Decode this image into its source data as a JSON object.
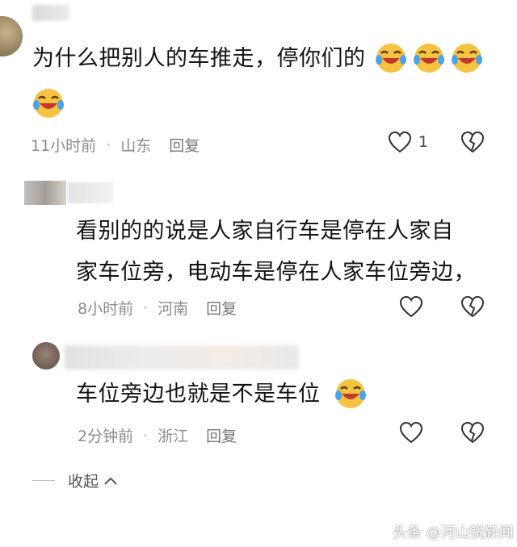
{
  "comments": [
    {
      "text_line1": "为什么把别人的车推走，停你们的",
      "time": "11小时前",
      "location": "山东",
      "reply": "回复",
      "likes": "1",
      "emoji_count": 4
    },
    {
      "text_line1": "看别的的说是人家自行车是停在人家自",
      "text_line2": "家车位旁，电动车是停在人家车位旁边，",
      "time": "8小时前",
      "location": "河南",
      "reply": "回复"
    },
    {
      "text_line1": "车位旁边也就是不是车位",
      "time": "2分钟前",
      "location": "浙江",
      "reply": "回复",
      "emoji_count": 1
    }
  ],
  "collapse_label": "收起",
  "watermark": "头条 @河山锐新闻",
  "colors": {
    "emoji_face": "#f5c341",
    "mouth": "#c0392b",
    "tear": "#4aa3e8",
    "meta": "#8c8c8c"
  }
}
